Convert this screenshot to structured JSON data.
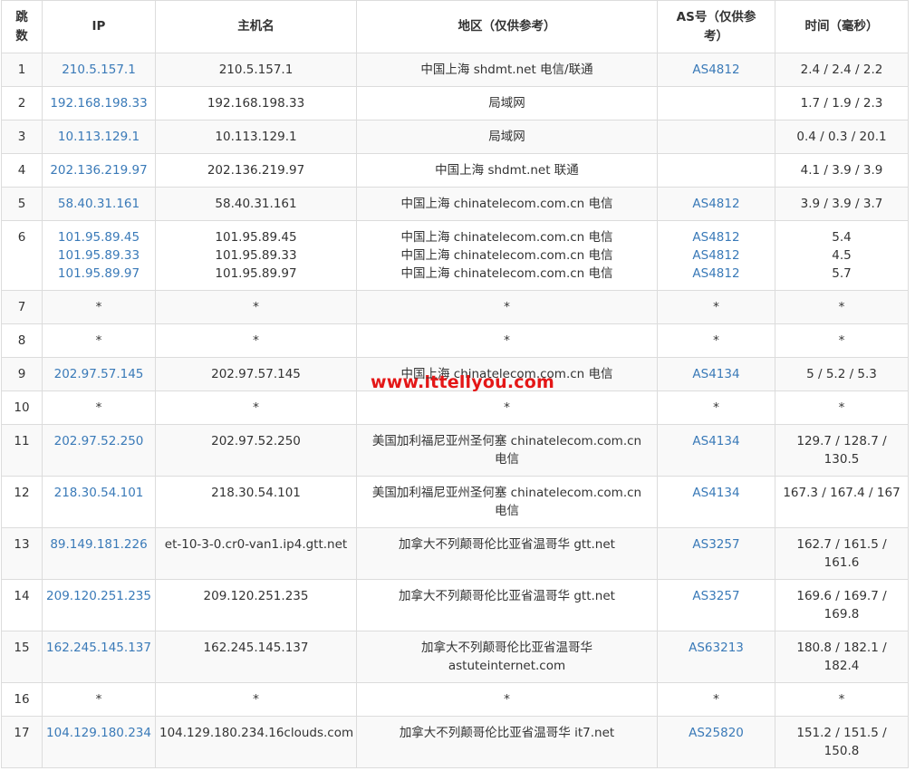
{
  "headers": {
    "hop": "跳数",
    "ip": "IP",
    "host": "主机名",
    "region": "地区（仅供参考）",
    "as": "AS号（仅供参考）",
    "time": "时间（毫秒）"
  },
  "watermark": "www.ittellyou.com",
  "colors": {
    "link": "#3a7ab8",
    "watermark": "#e41717",
    "border": "#dcdcdc",
    "stripe": "#f9f9f9"
  },
  "rows": [
    {
      "hop": "1",
      "ip": [
        "210.5.157.1"
      ],
      "host": [
        "210.5.157.1"
      ],
      "region": [
        "中国上海 shdmt.net 电信/联通"
      ],
      "as": [
        "AS4812"
      ],
      "time": [
        "2.4 / 2.4 / 2.2"
      ]
    },
    {
      "hop": "2",
      "ip": [
        "192.168.198.33"
      ],
      "host": [
        "192.168.198.33"
      ],
      "region": [
        "局域网"
      ],
      "as": [],
      "time": [
        "1.7 / 1.9 / 2.3"
      ]
    },
    {
      "hop": "3",
      "ip": [
        "10.113.129.1"
      ],
      "host": [
        "10.113.129.1"
      ],
      "region": [
        "局域网"
      ],
      "as": [],
      "time": [
        "0.4 / 0.3 / 20.1"
      ]
    },
    {
      "hop": "4",
      "ip": [
        "202.136.219.97"
      ],
      "host": [
        "202.136.219.97"
      ],
      "region": [
        "中国上海 shdmt.net 联通"
      ],
      "as": [],
      "time": [
        "4.1 / 3.9 / 3.9"
      ]
    },
    {
      "hop": "5",
      "ip": [
        "58.40.31.161"
      ],
      "host": [
        "58.40.31.161"
      ],
      "region": [
        "中国上海 chinatelecom.com.cn 电信"
      ],
      "as": [
        "AS4812"
      ],
      "time": [
        "3.9 / 3.9 / 3.7"
      ]
    },
    {
      "hop": "6",
      "ip": [
        "101.95.89.45",
        "101.95.89.33",
        "101.95.89.97"
      ],
      "host": [
        "101.95.89.45",
        "101.95.89.33",
        "101.95.89.97"
      ],
      "region": [
        "中国上海 chinatelecom.com.cn 电信",
        "中国上海 chinatelecom.com.cn 电信",
        "中国上海 chinatelecom.com.cn 电信"
      ],
      "as": [
        "AS4812",
        "AS4812",
        "AS4812"
      ],
      "time": [
        "5.4",
        "4.5",
        "5.7"
      ]
    },
    {
      "hop": "7",
      "ip": [
        "*"
      ],
      "host": [
        "*"
      ],
      "region": [
        "*"
      ],
      "as": [
        "*"
      ],
      "time": [
        "*"
      ]
    },
    {
      "hop": "8",
      "ip": [
        "*"
      ],
      "host": [
        "*"
      ],
      "region": [
        "*"
      ],
      "as": [
        "*"
      ],
      "time": [
        "*"
      ]
    },
    {
      "hop": "9",
      "ip": [
        "202.97.57.145"
      ],
      "host": [
        "202.97.57.145"
      ],
      "region": [
        "中国上海 chinatelecom.com.cn 电信"
      ],
      "as": [
        "AS4134"
      ],
      "time": [
        "5 / 5.2 / 5.3"
      ]
    },
    {
      "hop": "10",
      "ip": [
        "*"
      ],
      "host": [
        "*"
      ],
      "region": [
        "*"
      ],
      "as": [
        "*"
      ],
      "time": [
        "*"
      ]
    },
    {
      "hop": "11",
      "ip": [
        "202.97.52.250"
      ],
      "host": [
        "202.97.52.250"
      ],
      "region": [
        "美国加利福尼亚州圣何塞 chinatelecom.com.cn",
        "电信"
      ],
      "as": [
        "AS4134"
      ],
      "time": [
        "129.7 / 128.7 /",
        "130.5"
      ]
    },
    {
      "hop": "12",
      "ip": [
        "218.30.54.101"
      ],
      "host": [
        "218.30.54.101"
      ],
      "region": [
        "美国加利福尼亚州圣何塞 chinatelecom.com.cn",
        "电信"
      ],
      "as": [
        "AS4134"
      ],
      "time": [
        "167.3 / 167.4 / 167"
      ]
    },
    {
      "hop": "13",
      "ip": [
        "89.149.181.226"
      ],
      "host": [
        "et-10-3-0.cr0-van1.ip4.gtt.net"
      ],
      "region": [
        "加拿大不列颠哥伦比亚省温哥华 gtt.net"
      ],
      "as": [
        "AS3257"
      ],
      "time": [
        "162.7 / 161.5 /",
        "161.6"
      ]
    },
    {
      "hop": "14",
      "ip": [
        "209.120.251.235"
      ],
      "host": [
        "209.120.251.235"
      ],
      "region": [
        "加拿大不列颠哥伦比亚省温哥华 gtt.net"
      ],
      "as": [
        "AS3257"
      ],
      "time": [
        "169.6 / 169.7 /",
        "169.8"
      ]
    },
    {
      "hop": "15",
      "ip": [
        "162.245.145.137"
      ],
      "host": [
        "162.245.145.137"
      ],
      "region": [
        "加拿大不列颠哥伦比亚省温哥华",
        "astuteinternet.com"
      ],
      "as": [
        "AS63213"
      ],
      "time": [
        "180.8 / 182.1 /",
        "182.4"
      ]
    },
    {
      "hop": "16",
      "ip": [
        "*"
      ],
      "host": [
        "*"
      ],
      "region": [
        "*"
      ],
      "as": [
        "*"
      ],
      "time": [
        "*"
      ]
    },
    {
      "hop": "17",
      "ip": [
        "104.129.180.234"
      ],
      "host": [
        "104.129.180.234.16clouds.com"
      ],
      "region": [
        "加拿大不列颠哥伦比亚省温哥华 it7.net"
      ],
      "as": [
        "AS25820"
      ],
      "time": [
        "151.2 / 151.5 /",
        "150.8"
      ]
    }
  ]
}
